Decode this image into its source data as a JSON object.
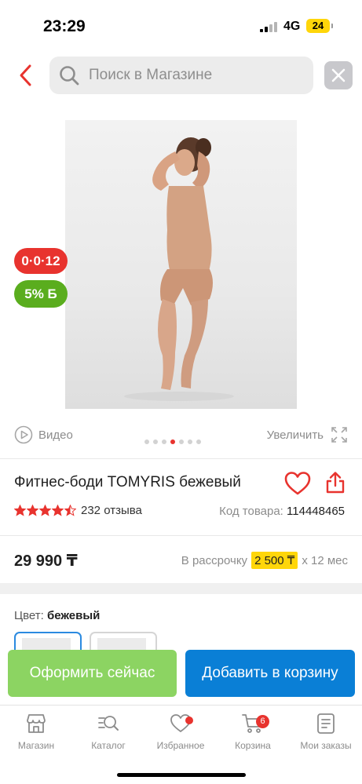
{
  "status_bar": {
    "time": "23:29",
    "network": "4G",
    "battery": "24"
  },
  "search": {
    "placeholder": "Поиск в Магазине"
  },
  "badges": {
    "installment": "0·0·12",
    "bonus": "5% Б"
  },
  "media": {
    "video_label": "Видео",
    "zoom_label": "Увеличить",
    "dots_total": 7,
    "dots_active_index": 3
  },
  "product": {
    "title": "Фитнес-боди TOMYRIS бежевый",
    "rating": 4.5,
    "reviews": "232 отзыва",
    "code_label": "Код товара:",
    "code": "114448465",
    "price": "29 990 ₸",
    "installment_prefix": "В рассрочку",
    "installment_amount": "2 500 ₸",
    "installment_suffix": "x 12 мес",
    "color_label": "Цвет:",
    "color_value": "бежевый"
  },
  "actions": {
    "buy_now": "Оформить сейчас",
    "add_to_cart": "Добавить в корзину"
  },
  "tabbar": {
    "items": [
      {
        "label": "Магазин",
        "icon": "shop-icon"
      },
      {
        "label": "Каталог",
        "icon": "catalog-search-icon"
      },
      {
        "label": "Избранное",
        "icon": "heart-icon"
      },
      {
        "label": "Корзина",
        "icon": "cart-icon",
        "badge": "6"
      },
      {
        "label": "Мои заказы",
        "icon": "orders-icon"
      }
    ]
  },
  "colors": {
    "accent_red": "#e8332e",
    "green": "#5aad1e",
    "button_green": "#8cd462",
    "button_blue": "#0a7fd6",
    "highlight_yellow": "#ffd60a"
  }
}
